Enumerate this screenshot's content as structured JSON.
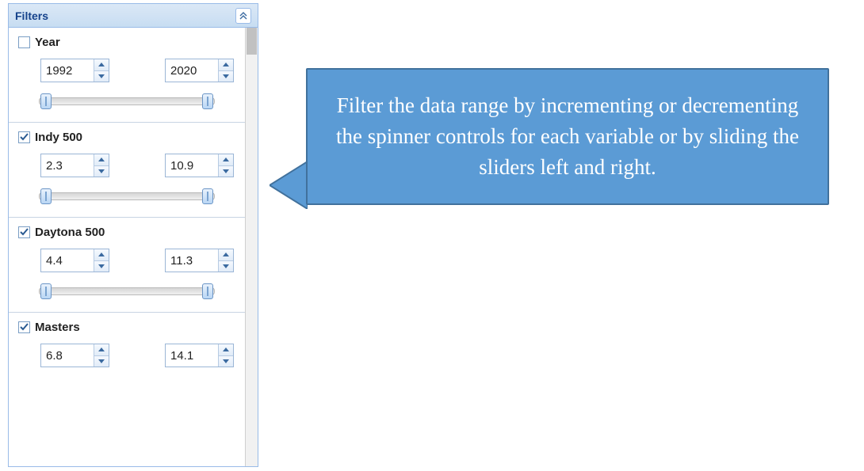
{
  "panel": {
    "title": "Filters",
    "filters": [
      {
        "label": "Year",
        "checked": false,
        "min": "1992",
        "max": "2020"
      },
      {
        "label": "Indy 500",
        "checked": true,
        "min": "2.3",
        "max": "10.9"
      },
      {
        "label": "Daytona 500",
        "checked": true,
        "min": "4.4",
        "max": "11.3"
      },
      {
        "label": "Masters",
        "checked": true,
        "min": "6.8",
        "max": "14.1"
      }
    ]
  },
  "callout": {
    "text": "Filter the data range by incrementing or decrementing the spinner controls for each variable or by sliding the sliders left and right."
  }
}
